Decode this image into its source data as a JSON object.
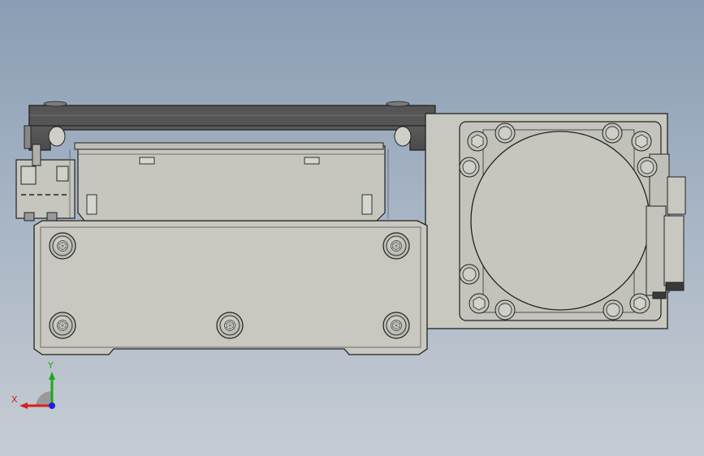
{
  "viewport": {
    "background_top": "#8a9db4",
    "background_bottom": "#c6ccd3"
  },
  "triad": {
    "x_label": "X",
    "y_label": "Y",
    "x_color": "#d81e1e",
    "y_color": "#1ea81e",
    "z_color": "#1e1ed8"
  },
  "colors": {
    "body": "#c8c8c0",
    "top_rail": "#5a5a5a",
    "outline": "#222222"
  }
}
